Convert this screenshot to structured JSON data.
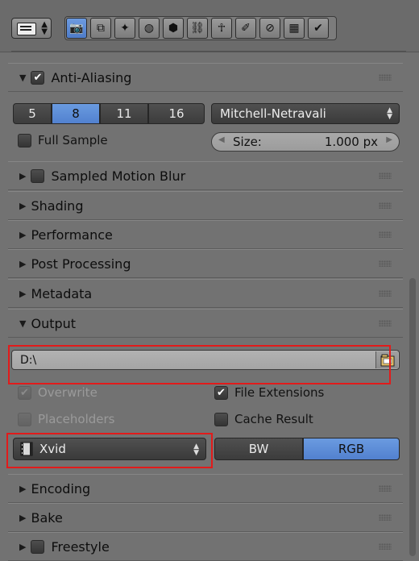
{
  "header": {
    "editor_type_icon": "properties-editor-icon",
    "context_tabs": [
      {
        "icon": "render-camera-icon",
        "glyph": "📷",
        "active": true
      },
      {
        "icon": "render-layers-icon",
        "glyph": "⧉",
        "active": false
      },
      {
        "icon": "scene-icon",
        "glyph": "✦",
        "active": false
      },
      {
        "icon": "world-icon",
        "glyph": "◍",
        "active": false
      },
      {
        "icon": "object-icon",
        "glyph": "⬢",
        "active": false
      },
      {
        "icon": "constraints-icon",
        "glyph": "⛓",
        "active": false
      },
      {
        "icon": "modifiers-icon",
        "glyph": "☥",
        "active": false
      },
      {
        "icon": "data-icon",
        "glyph": "✐",
        "active": false
      },
      {
        "icon": "material-icon",
        "glyph": "⊘",
        "active": false
      },
      {
        "icon": "texture-icon",
        "glyph": "▦",
        "active": false
      },
      {
        "icon": "particles-icon",
        "glyph": "✔",
        "active": false
      }
    ]
  },
  "anti_aliasing": {
    "label": "Anti-Aliasing",
    "enabled": true,
    "samples": [
      "5",
      "8",
      "11",
      "16"
    ],
    "selected_sample": "8",
    "filter": "Mitchell-Netravali",
    "full_sample_label": "Full Sample",
    "size_label": "Size:",
    "size_value": "1.000 px"
  },
  "panels_collapsed": {
    "sampled_motion_blur": "Sampled Motion Blur",
    "shading": "Shading",
    "performance": "Performance",
    "post_processing": "Post Processing",
    "metadata": "Metadata"
  },
  "output": {
    "label": "Output",
    "path": "D:\\",
    "overwrite_label": "Overwrite",
    "file_extensions_label": "File Extensions",
    "placeholders_label": "Placeholders",
    "cache_result_label": "Cache Result",
    "format": "Xvid",
    "color_modes": [
      "BW",
      "RGB"
    ],
    "selected_color_mode": "RGB"
  },
  "panels_bottom": {
    "encoding": "Encoding",
    "bake": "Bake",
    "freestyle": "Freestyle"
  },
  "colors": {
    "highlight_box": "#e21b1b",
    "selected_blue": "#5a8bd6"
  }
}
